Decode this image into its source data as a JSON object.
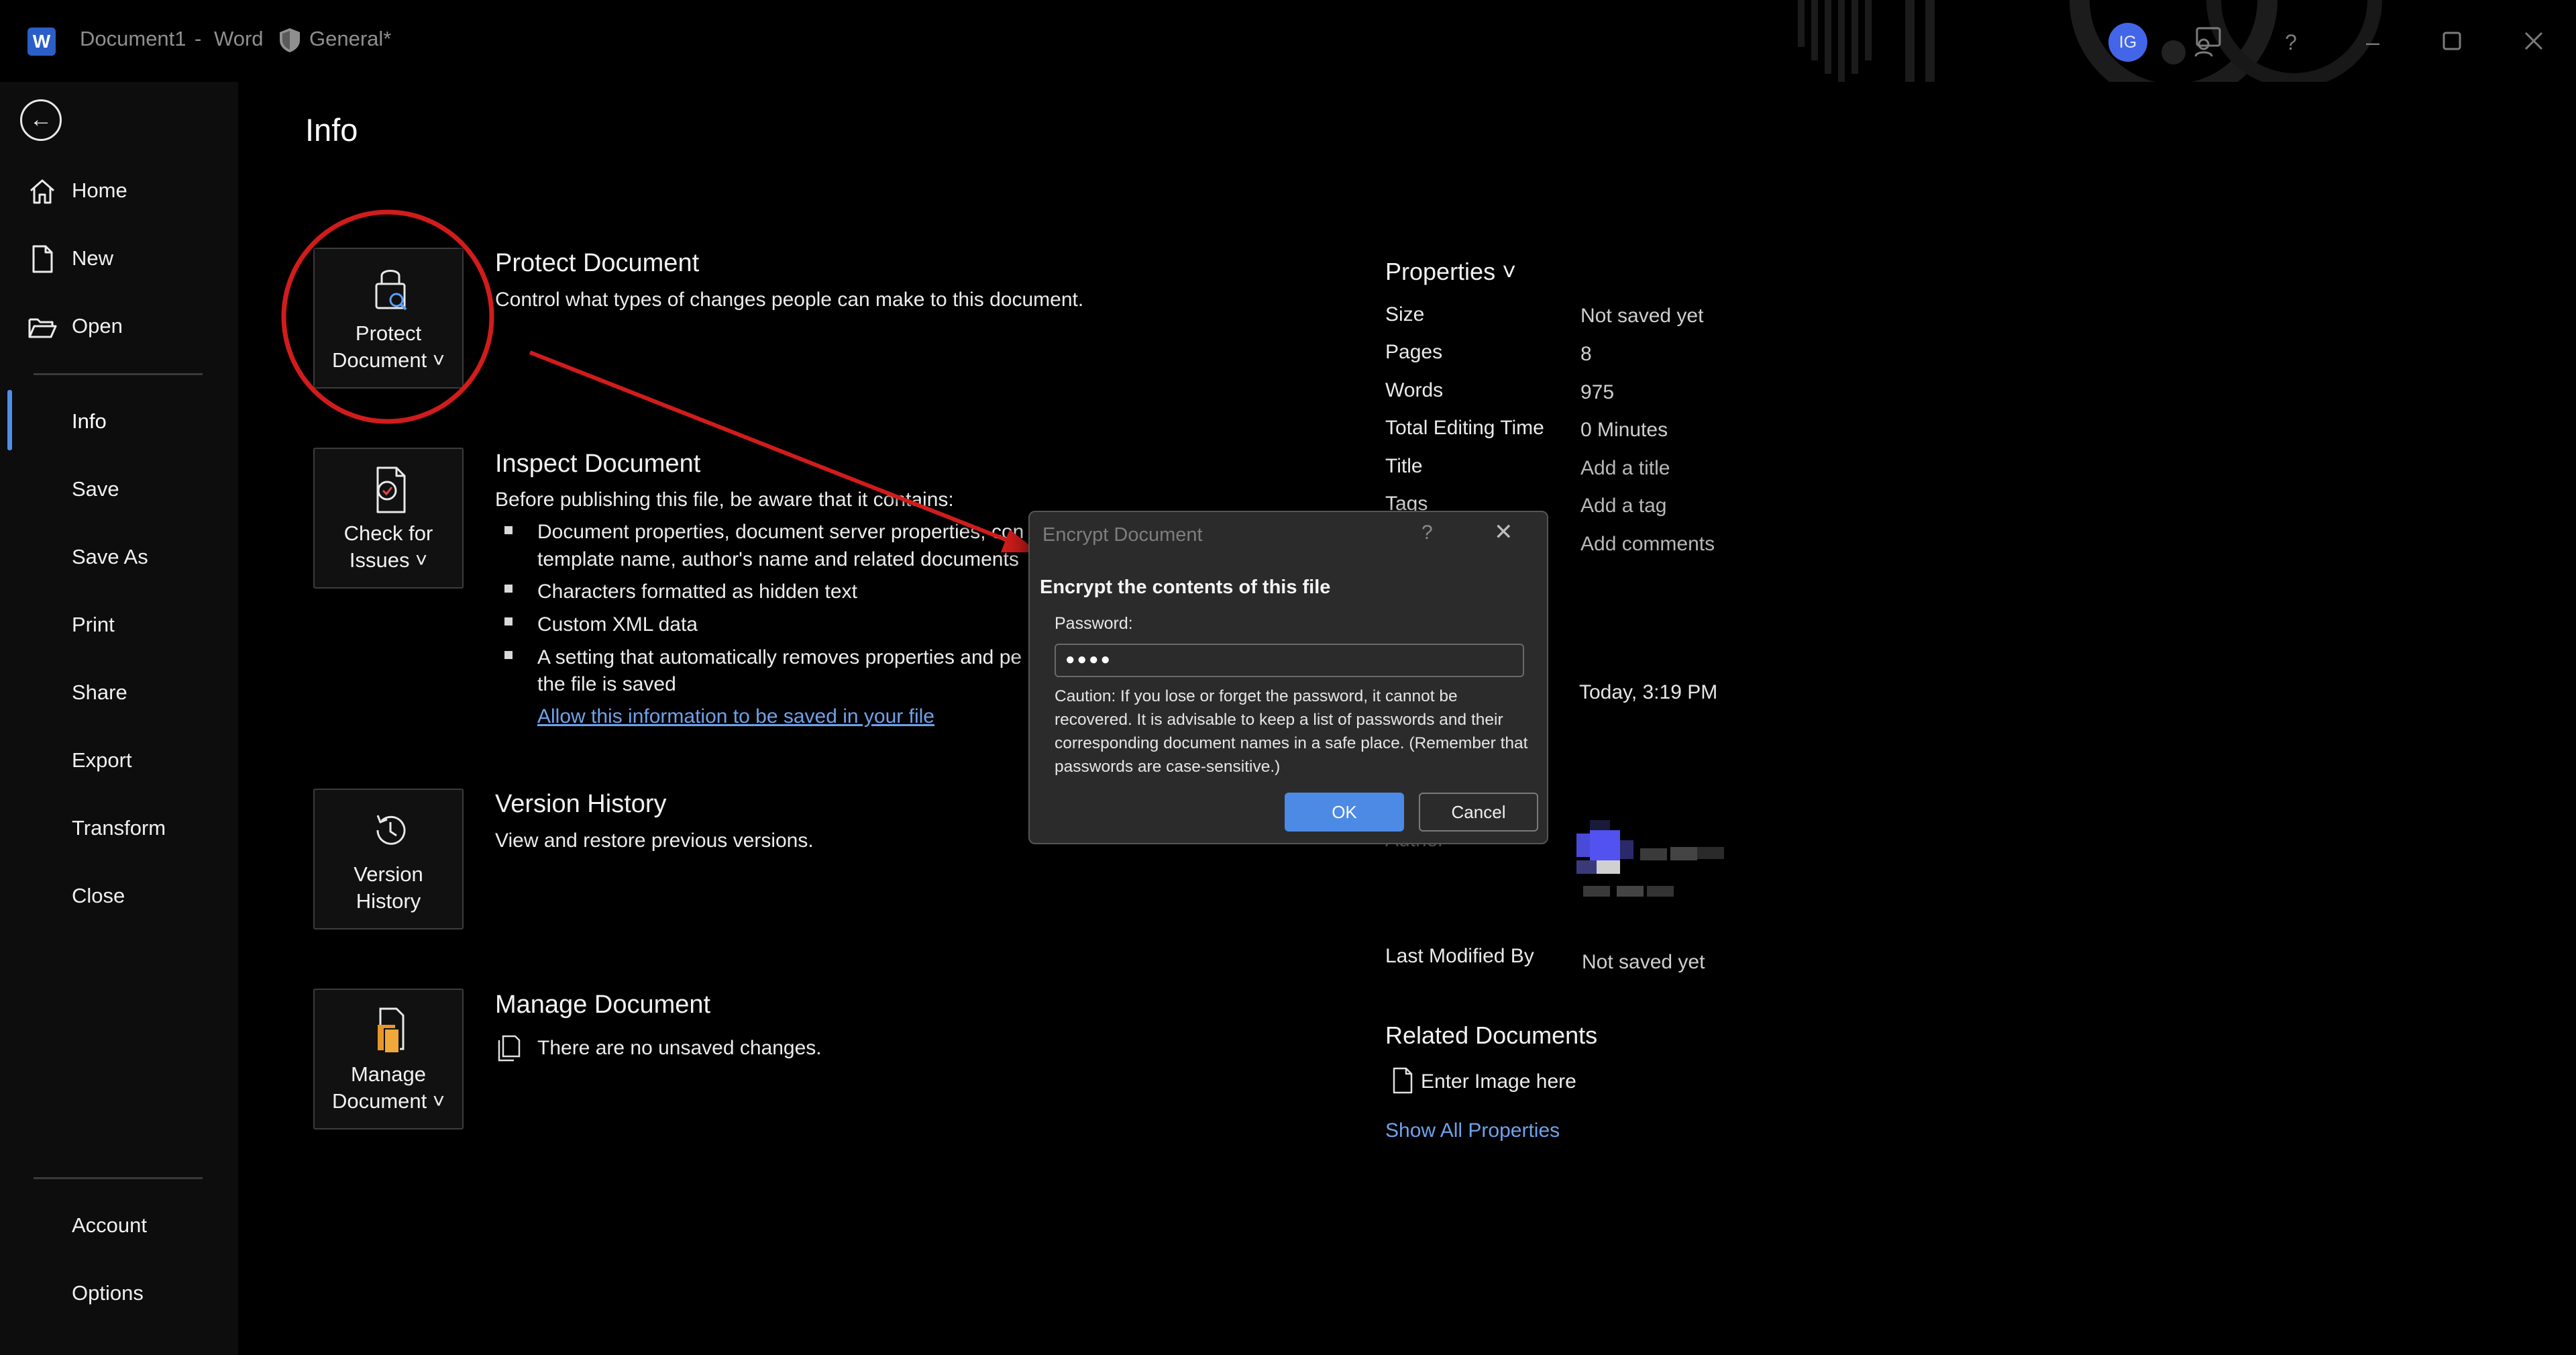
{
  "titlebar": {
    "doc_name": "Document1",
    "separator": "-",
    "app_name": "Word",
    "sensitivity": "General*",
    "avatar_initials": "IG"
  },
  "nav": {
    "back_icon": "back-arrow-icon",
    "items": [
      {
        "label": "Home",
        "icon": "home-icon"
      },
      {
        "label": "New",
        "icon": "new-document-icon"
      },
      {
        "label": "Open",
        "icon": "folder-open-icon"
      },
      {
        "label": "Info"
      },
      {
        "label": "Save"
      },
      {
        "label": "Save As"
      },
      {
        "label": "Print"
      },
      {
        "label": "Share"
      },
      {
        "label": "Export"
      },
      {
        "label": "Transform"
      },
      {
        "label": "Close"
      },
      {
        "label": "Account"
      },
      {
        "label": "Options"
      }
    ],
    "selected": "Info"
  },
  "main": {
    "title": "Info",
    "protect": {
      "tile_label": "Protect\nDocument ˅",
      "heading": "Protect Document",
      "desc": "Control what types of changes people can make to this document."
    },
    "inspect": {
      "tile_label": "Check for\nIssues ˅",
      "heading": "Inspect Document",
      "desc": "Before publishing this file, be aware that it contains:",
      "bullets": [
        "Document properties, document server properties, con",
        "template name, author's name and related documents",
        "Characters formatted as hidden text",
        "Custom XML data",
        "A setting that automatically removes properties and pe",
        "the file is saved"
      ],
      "link": "Allow this information to be saved in your file"
    },
    "version": {
      "tile_label": "Version\nHistory",
      "heading": "Version History",
      "desc": "View and restore previous versions."
    },
    "manage": {
      "tile_label": "Manage\nDocument ˅",
      "heading": "Manage Document",
      "desc": "There are no unsaved changes."
    }
  },
  "properties": {
    "header": "Properties ˅",
    "rows": [
      {
        "key": "Size",
        "value": "Not saved yet"
      },
      {
        "key": "Pages",
        "value": "8"
      },
      {
        "key": "Words",
        "value": "975"
      },
      {
        "key": "Total Editing Time",
        "value": "0 Minutes"
      },
      {
        "key": "Title",
        "value": "Add a title"
      },
      {
        "key": "Tags",
        "value": "Add a tag"
      },
      {
        "key": "",
        "value": "Add comments"
      }
    ],
    "created_value": "Today, 3:19 PM",
    "author_key": "Author",
    "last_modified_key": "Last Modified By",
    "last_modified_value": "Not saved yet",
    "related_heading": "Related Documents",
    "related_item": "Enter Image here",
    "show_all": "Show All Properties"
  },
  "dialog": {
    "title": "Encrypt Document",
    "help": "?",
    "close": "✕",
    "heading": "Encrypt the contents of this file",
    "password_label": "Password:",
    "password_value": "●●●●",
    "caution": "Caution: If you lose or forget the password, it cannot be recovered. It is advisable to keep a list of passwords and their corresponding document names in a safe place. (Remember that passwords are case-sensitive.)",
    "ok": "OK",
    "cancel": "Cancel"
  },
  "colors": {
    "accent": "#4c8ae6",
    "annotation_red": "#d11a1a",
    "link": "#6ea2ec"
  }
}
